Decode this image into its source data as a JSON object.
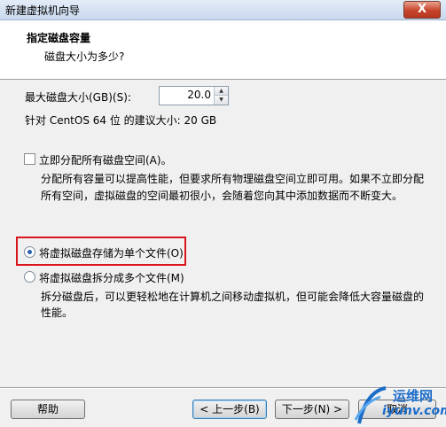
{
  "window": {
    "title": "新建虚拟机向导",
    "close_label": "X"
  },
  "header": {
    "title": "指定磁盘容量",
    "subtitle": "磁盘大小为多少?"
  },
  "disk": {
    "max_size_label": "最大磁盘大小(GB)(S):",
    "max_size_value": "20.0",
    "recommended": "针对 CentOS 64 位 的建议大小: 20 GB"
  },
  "allocate": {
    "checkbox_label": "立即分配所有磁盘空间(A)。",
    "checked": false,
    "description_line1": "分配所有容量可以提高性能，但要求所有物理磁盘空间立即可用。如果不立即分配",
    "description_line2": "所有空间，虚拟磁盘的空间最初很小，会随着您向其中添加数据而不断变大。"
  },
  "storage": {
    "single_label": "将虚拟磁盘存储为单个文件(O)",
    "single_selected": true,
    "split_label": "将虚拟磁盘拆分成多个文件(M)",
    "split_selected": false,
    "split_description_line1": "拆分磁盘后，可以更轻松地在计算机之间移动虚拟机，但可能会降低大容量磁盘的",
    "split_description_line2": "性能。"
  },
  "buttons": {
    "help": "帮助",
    "back": "< 上一步(B)",
    "next": "下一步(N) >",
    "cancel": "取消"
  },
  "watermark": {
    "text": "运维网",
    "sub": "iyunv.com"
  },
  "colors": {
    "highlight_border": "#d9151b",
    "watermark": "#1b6cc9"
  }
}
